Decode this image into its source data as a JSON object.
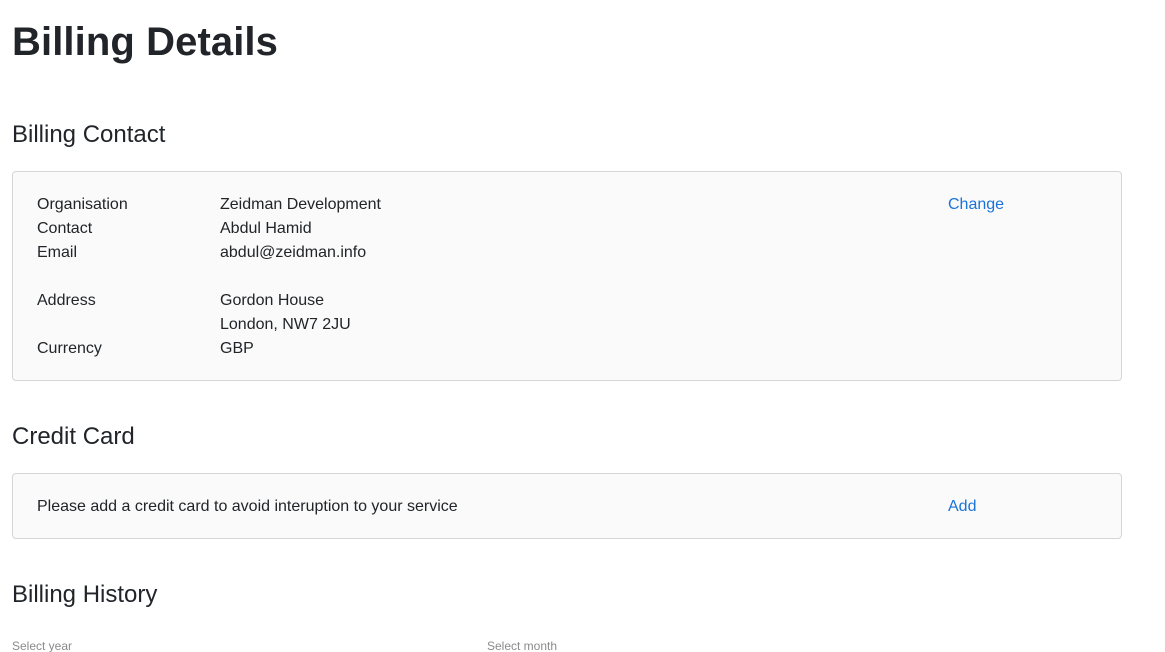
{
  "page": {
    "title": "Billing Details"
  },
  "billing_contact": {
    "heading": "Billing Contact",
    "change_label": "Change",
    "fields": {
      "organisation_label": "Organisation",
      "organisation_value": "Zeidman Development",
      "contact_label": "Contact",
      "contact_value": "Abdul Hamid",
      "email_label": "Email",
      "email_value": "abdul@zeidman.info",
      "address_label": "Address",
      "address_line1": "Gordon House",
      "address_line2": "London, NW7 2JU",
      "currency_label": "Currency",
      "currency_value": "GBP"
    }
  },
  "credit_card": {
    "heading": "Credit Card",
    "message": "Please add a credit card to avoid interuption to your service",
    "add_label": "Add"
  },
  "billing_history": {
    "heading": "Billing History",
    "select_year_label": "Select year",
    "select_month_label": "Select month"
  }
}
